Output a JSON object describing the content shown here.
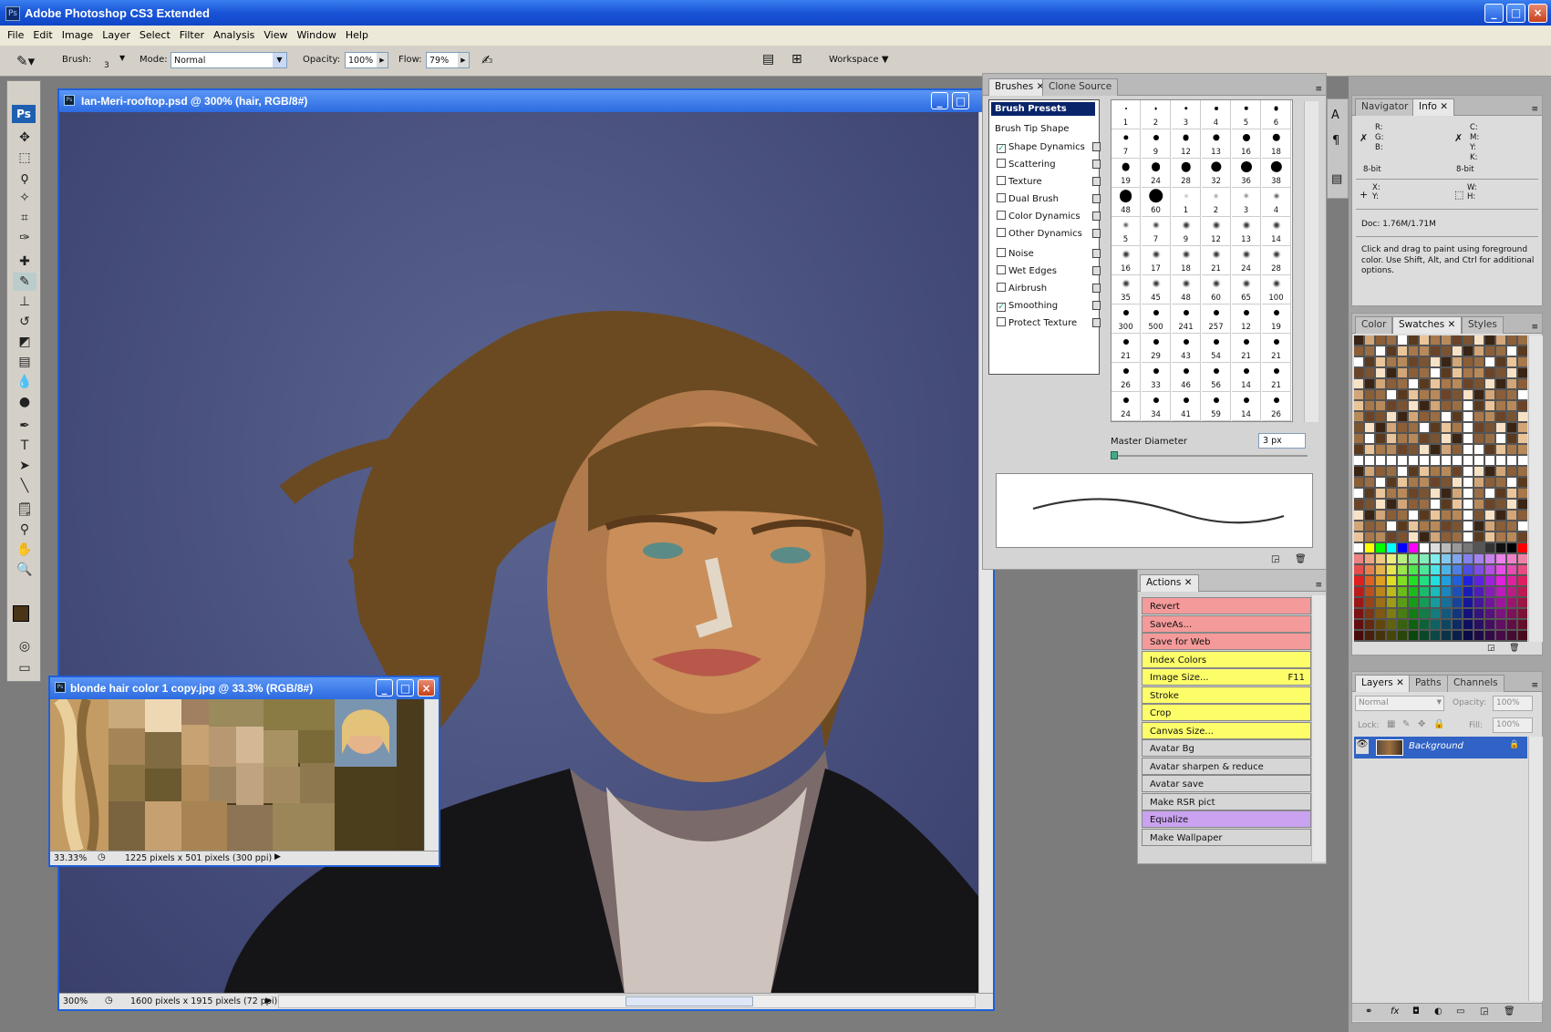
{
  "app": {
    "title": "Adobe Photoshop CS3 Extended"
  },
  "menu": [
    "File",
    "Edit",
    "Image",
    "Layer",
    "Select",
    "Filter",
    "Analysis",
    "View",
    "Window",
    "Help"
  ],
  "options": {
    "brush_label": "Brush:",
    "brush_size": "3",
    "mode_label": "Mode:",
    "mode_value": "Normal",
    "opacity_label": "Opacity:",
    "opacity_value": "100%",
    "flow_label": "Flow:",
    "flow_value": "79%",
    "workspace_label": "Workspace"
  },
  "main_doc": {
    "title": "Ian-Meri-rooftop.psd @ 300% (hair, RGB/8#)",
    "zoom": "300%",
    "info": "1600 pixels x 1915 pixels (72 ppi)"
  },
  "second_doc": {
    "title": "blonde hair color 1 copy.jpg @ 33.3% (RGB/8#)",
    "zoom": "33.33%",
    "info": "1225 pixels x 501 pixels (300 ppi)"
  },
  "brushes": {
    "tabs": [
      "Brushes",
      "Clone Source"
    ],
    "presets_label": "Brush Presets",
    "tip_label": "Brush Tip Shape",
    "options": [
      {
        "label": "Shape Dynamics",
        "checked": true
      },
      {
        "label": "Scattering",
        "checked": false
      },
      {
        "label": "Texture",
        "checked": false
      },
      {
        "label": "Dual Brush",
        "checked": false
      },
      {
        "label": "Color Dynamics",
        "checked": false
      },
      {
        "label": "Other Dynamics",
        "checked": false
      },
      {
        "label": "Noise",
        "checked": false
      },
      {
        "label": "Wet Edges",
        "checked": false
      },
      {
        "label": "Airbrush",
        "checked": false
      },
      {
        "label": "Smoothing",
        "checked": true
      },
      {
        "label": "Protect Texture",
        "checked": false
      }
    ],
    "sizes": [
      "1",
      "2",
      "3",
      "4",
      "5",
      "6",
      "7",
      "9",
      "12",
      "13",
      "16",
      "18",
      "19",
      "24",
      "28",
      "32",
      "36",
      "38",
      "48",
      "60",
      "1",
      "2",
      "3",
      "4",
      "5",
      "7",
      "9",
      "12",
      "13",
      "14",
      "16",
      "17",
      "18",
      "21",
      "24",
      "28",
      "35",
      "45",
      "48",
      "60",
      "65",
      "100",
      "300",
      "500",
      "241",
      "257",
      "12",
      "19",
      "21",
      "29",
      "43",
      "54",
      "21",
      "21",
      "26",
      "33",
      "46",
      "56",
      "14",
      "21",
      "24",
      "34",
      "41",
      "59",
      "14",
      "26"
    ],
    "master_label": "Master Diameter",
    "master_value": "3 px"
  },
  "actions": {
    "tab": "Actions",
    "items": [
      {
        "label": "Revert",
        "color": "#f59a9a"
      },
      {
        "label": "SaveAs...",
        "color": "#f59a9a"
      },
      {
        "label": "Save for Web",
        "color": "#f59a9a"
      },
      {
        "label": "Index Colors",
        "color": "#fdfd6a"
      },
      {
        "label": "Image Size...",
        "key": "F11",
        "color": "#fdfd6a"
      },
      {
        "label": "Stroke",
        "color": "#fdfd6a"
      },
      {
        "label": "Crop",
        "color": "#fdfd6a"
      },
      {
        "label": "Canvas Size...",
        "color": "#fdfd6a"
      },
      {
        "label": "Avatar Bg",
        "color": "#d6d6d6"
      },
      {
        "label": "Avatar sharpen & reduce",
        "color": "#d6d6d6"
      },
      {
        "label": "Avatar save",
        "color": "#d6d6d6"
      },
      {
        "label": "Make RSR pict",
        "color": "#d6d6d6"
      },
      {
        "label": "Equalize",
        "color": "#c9a3f0"
      },
      {
        "label": "Make Wallpaper",
        "color": "#d6d6d6"
      }
    ]
  },
  "info": {
    "tabs": [
      "Navigator",
      "Info"
    ],
    "rgb": "R:\nG:\nB:",
    "cmyk": "C:\nM:\nY:\nK:",
    "bit_left": "8-bit",
    "bit_right": "8-bit",
    "xy": "X:\nY:",
    "wh": "W:\nH:",
    "doc": "Doc: 1.76M/1.71M",
    "hint": "Click and drag to paint using foreground color. Use Shift, Alt, and Ctrl for additional options."
  },
  "swatches": {
    "tabs": [
      "Color",
      "Swatches",
      "Styles"
    ]
  },
  "layers": {
    "tabs": [
      "Layers",
      "Paths",
      "Channels"
    ],
    "blend": "Normal",
    "opacity_label": "Opacity:",
    "opacity_value": "100%",
    "lock_label": "Lock:",
    "fill_label": "Fill:",
    "fill_value": "100%",
    "layer_name": "Background"
  },
  "colors": {
    "accent": "#0a246a",
    "xp_title": "#1a55d8",
    "canvas_bg": "#4a5180",
    "hair": "#6b4a22"
  }
}
